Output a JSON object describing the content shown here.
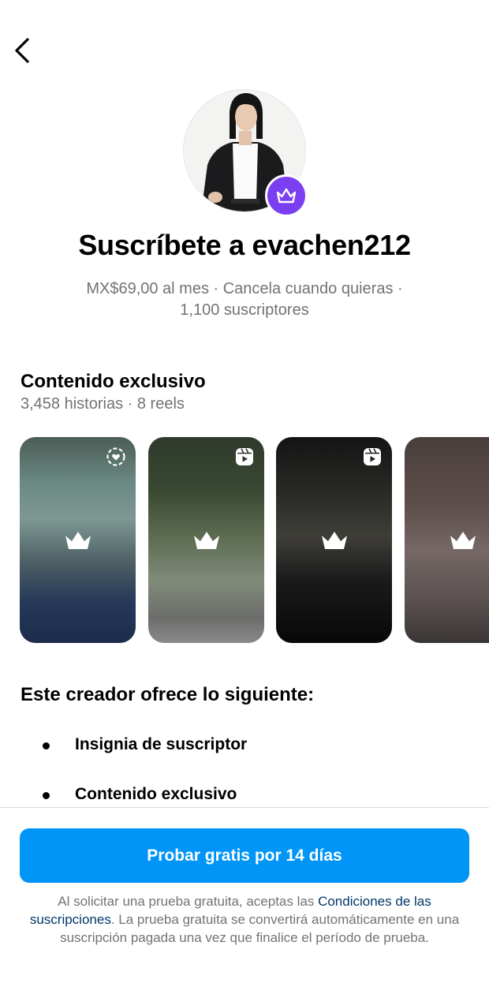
{
  "header": {
    "back_icon": "chevron-left-icon"
  },
  "profile": {
    "badge_icon": "crown-icon",
    "badge_color": "#7b3ff2"
  },
  "title": "Suscríbete a evachen212",
  "subtitle_line1": "MX$69,00 al mes · Cancela cuando quieras ·",
  "subtitle_line2": "1,100 suscriptores",
  "exclusive": {
    "title": "Contenido exclusivo",
    "subtitle": "3,458 historias · 8 reels",
    "thumbnails": [
      {
        "type_icon": "story-highlight-icon",
        "lock_icon": "crown-icon"
      },
      {
        "type_icon": "reels-icon",
        "lock_icon": "crown-icon"
      },
      {
        "type_icon": "reels-icon",
        "lock_icon": "crown-icon"
      },
      {
        "type_icon": "",
        "lock_icon": "crown-icon"
      }
    ]
  },
  "offers": {
    "title": "Este creador ofrece lo siguiente:",
    "items": [
      {
        "label": "Insignia de suscriptor"
      },
      {
        "label": "Contenido exclusivo"
      }
    ]
  },
  "cta": {
    "label": "Probar gratis por 14 días",
    "color": "#0095f6"
  },
  "legal": {
    "prefix": "Al solicitar una prueba gratuita, aceptas las ",
    "link": "Condiciones de las suscripciones",
    "suffix": ". La prueba gratuita se convertirá automáticamente en una suscripción pagada una vez que finalice el período de prueba."
  }
}
